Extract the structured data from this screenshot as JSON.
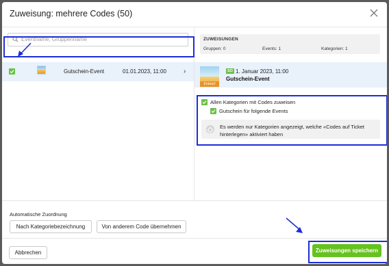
{
  "dialog": {
    "title": "Zuweisung: mehrere Codes (50)",
    "close_icon": "close-icon"
  },
  "search": {
    "placeholder": "Eventname, Gruppenname",
    "icon": "search-icon"
  },
  "events": [
    {
      "checked": true,
      "name": "Gutschein-Event",
      "date": "01.01.2023, 11:00",
      "chevron": "›"
    }
  ],
  "summary": {
    "title": "ZUWEISUNGEN",
    "groups": "Gruppen: 0",
    "events": "Events: 1",
    "categories": "Kategorien: 1"
  },
  "event_card": {
    "status_badge": "Entwurf",
    "weekday_badge": "SO",
    "date": "1. Januar 2023, 11:00",
    "name": "Gutschein-Event"
  },
  "options": {
    "all_categories": "Allen Kategorien mit Codes zuweisen",
    "voucher_for_events": "Gutschein für folgende Events",
    "info_text": "Es werden nur Kategorien angezeigt, welche «Codes auf Ticket hinterlegen» aktiviert haben"
  },
  "auto_assign": {
    "title": "Automatische Zuordnung",
    "by_category_label": "Nach Kategoriebezeichnung",
    "from_other_code_label": "Von anderem Code übernehmen"
  },
  "footer": {
    "cancel_label": "Abbrechen",
    "save_label": "Zuweisungen speichern"
  },
  "colors": {
    "accent_green": "#66c21f",
    "checkbox_green": "#6cc04a",
    "annotation_blue": "#1c2ed6",
    "selected_row": "#e9f1fb"
  }
}
